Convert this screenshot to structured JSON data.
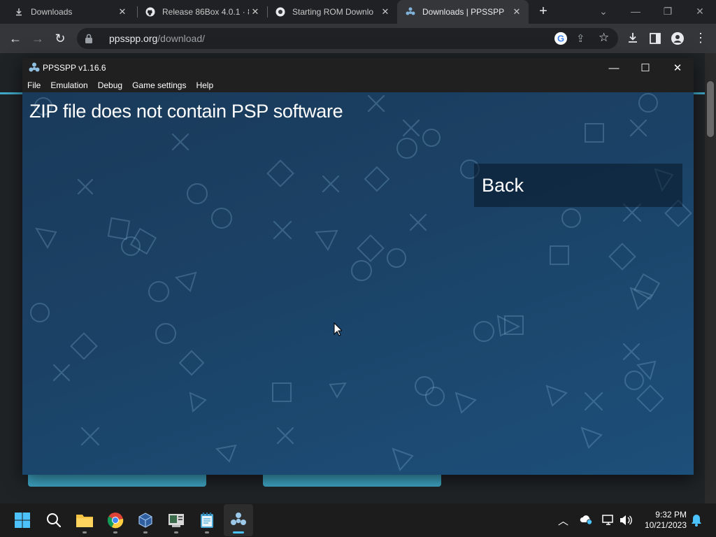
{
  "browser": {
    "tabs": [
      {
        "title": "Downloads",
        "icon": "download-icon",
        "active": false
      },
      {
        "title": "Release 86Box 4.0.1 · 86",
        "icon": "github-icon",
        "active": false
      },
      {
        "title": "Starting ROM Downlo",
        "icon": "chrome-icon",
        "active": false
      },
      {
        "title": "Downloads | PPSSPP",
        "icon": "ppsspp-icon",
        "active": true
      }
    ],
    "new_tab": "+",
    "address": {
      "host": "ppsspp.org",
      "path": "/download/"
    }
  },
  "app": {
    "title": "PPSSPP v1.16.6",
    "menu": [
      "File",
      "Emulation",
      "Debug",
      "Game settings",
      "Help"
    ],
    "message": "ZIP file does not contain PSP software",
    "back_label": "Back"
  },
  "taskbar": {
    "time": "9:32 PM",
    "date": "10/21/2023"
  },
  "colors": {
    "accent": "#3fa7c7",
    "taskbar_indicator": "#4cc2ff",
    "app_background": "#1b4266"
  }
}
